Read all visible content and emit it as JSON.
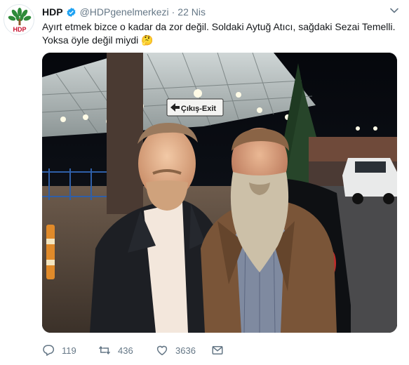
{
  "tweet": {
    "author_name": "HDP",
    "handle": "@HDPgenelmerkezi",
    "separator": "·",
    "date": "22 Nis",
    "avatar_text": "HDP",
    "text_line1": "Ayırt etmek bizce o kadar da zor değil. Soldaki Aytuğ Atıcı, sağdaki Sezai Temelli.",
    "text_line2": "Yoksa öyle değil miydi 🤔",
    "sign_text": "Çıkış-Exit",
    "actions": {
      "replies": "119",
      "retweets": "436",
      "likes": "3636"
    }
  },
  "colors": {
    "verified": "#1da1f2",
    "muted": "#657786",
    "text": "#14171a",
    "logo_green": "#2e8b3a",
    "logo_red": "#c8102e"
  },
  "icons": {
    "verified": "verified-badge-icon",
    "caret": "chevron-down-icon",
    "reply": "reply-icon",
    "retweet": "retweet-icon",
    "like": "heart-icon",
    "message": "envelope-icon"
  }
}
